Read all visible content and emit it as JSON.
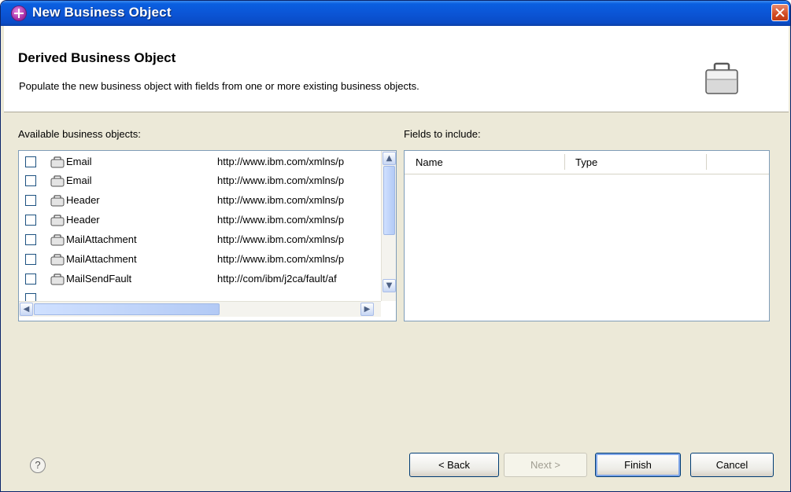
{
  "window": {
    "title": "New Business Object"
  },
  "banner": {
    "title": "Derived Business Object",
    "description": "Populate the new business object with fields from one or more existing business objects."
  },
  "available": {
    "label": "Available business objects:",
    "items": [
      {
        "name": "Email",
        "namespace": "http://www.ibm.com/xmlns/p",
        "checked": false
      },
      {
        "name": "Email",
        "namespace": "http://www.ibm.com/xmlns/p",
        "checked": false
      },
      {
        "name": "Header",
        "namespace": "http://www.ibm.com/xmlns/p",
        "checked": false
      },
      {
        "name": "Header",
        "namespace": "http://www.ibm.com/xmlns/p",
        "checked": false
      },
      {
        "name": "MailAttachment",
        "namespace": "http://www.ibm.com/xmlns/p",
        "checked": false
      },
      {
        "name": "MailAttachment",
        "namespace": "http://www.ibm.com/xmlns/p",
        "checked": false
      },
      {
        "name": "MailSendFault",
        "namespace": "http://com/ibm/j2ca/fault/af",
        "checked": false
      }
    ]
  },
  "fields": {
    "label": "Fields to include:",
    "columns": [
      "Name",
      "Type"
    ]
  },
  "buttons": {
    "back": "< Back",
    "next": "Next >",
    "finish": "Finish",
    "cancel": "Cancel",
    "help": "?"
  },
  "icons": {
    "app": "business-object-plus-icon",
    "banner": "briefcase-icon",
    "item": "business-object-icon",
    "close": "close-icon",
    "help": "help-icon"
  },
  "colors": {
    "titlebar": "#0b55d6",
    "dialog_bg": "#ece9d8",
    "border": "#7f9db9"
  }
}
